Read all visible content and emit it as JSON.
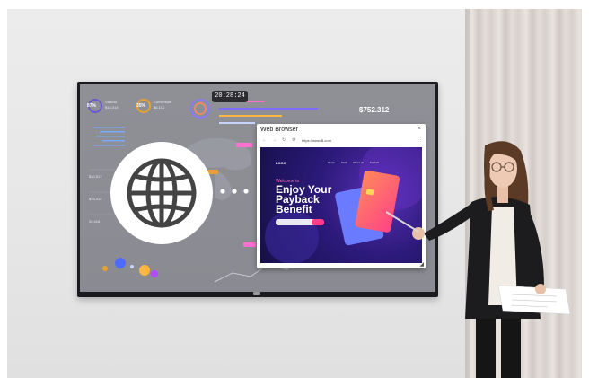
{
  "dashboard": {
    "clock": "20:28:24",
    "stat_1_label": "Visitors",
    "stat_1_value": "$14,313",
    "stat_1_pct": "87%",
    "stat_2_label": "Conversion",
    "stat_2_value": "$6,114",
    "stat_2_pct": "35%",
    "amount": "$752.312",
    "side_values": [
      "$10,517",
      "$15,312",
      "26,416"
    ]
  },
  "browser": {
    "title": "Web Browser",
    "url": "https://www.lll.com",
    "close_glyph": "×",
    "back_glyph": "←",
    "forward_glyph": "→",
    "refresh_glyph": "↻",
    "settings_glyph": "⚙",
    "menu_glyph": "⋮"
  },
  "site": {
    "logo": "LOGO",
    "nav": [
      "Home",
      "Card",
      "About us",
      "Contact"
    ],
    "welcome": "Welcome to",
    "headline_1": "Enjoy Your",
    "headline_2": "Payback",
    "headline_3": "Benefit",
    "card_front_label": "CREDIT CARD",
    "card_back_label": "CREDIT CARD"
  },
  "colors": {
    "accent_pink": "#ff3d8b",
    "site_bg": "#1d1360",
    "card_orange": "#ff7a5a"
  }
}
